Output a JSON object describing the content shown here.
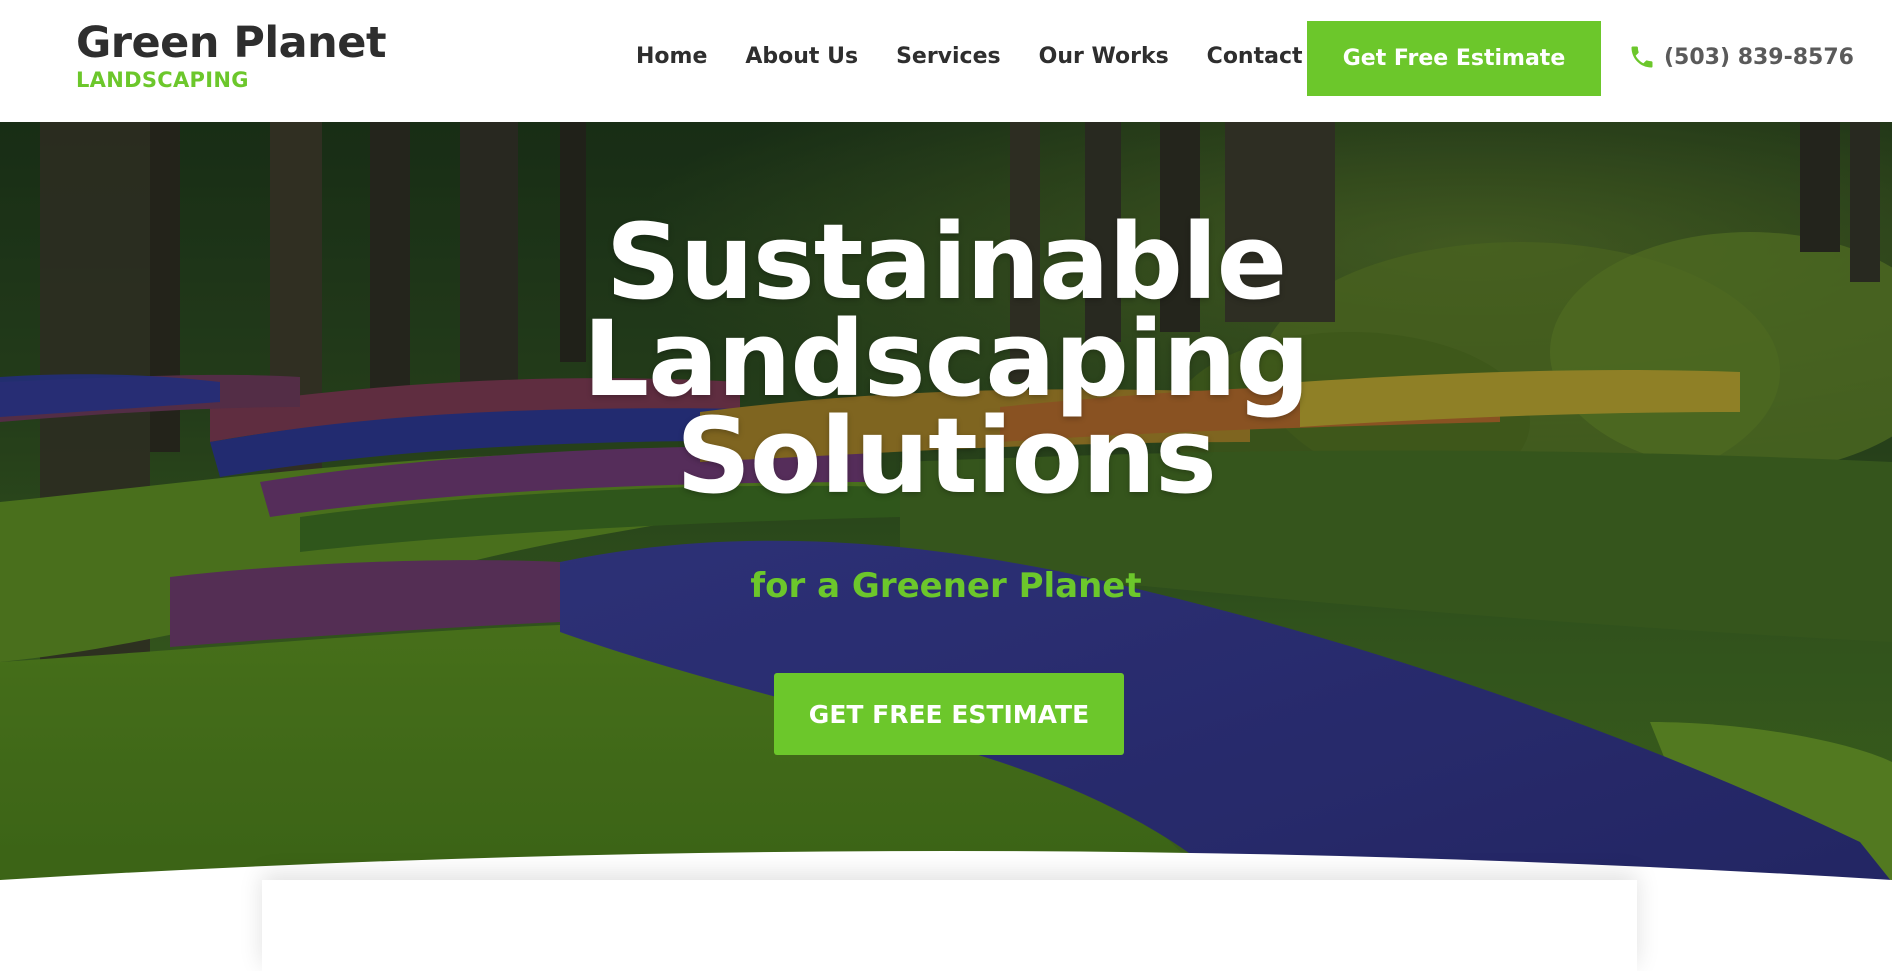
{
  "header": {
    "logo": {
      "title": "Green Planet",
      "subtitle": "LANDSCAPING"
    },
    "nav": [
      {
        "label": "Home"
      },
      {
        "label": "About Us"
      },
      {
        "label": "Services"
      },
      {
        "label": "Our Works"
      },
      {
        "label": "Contact"
      }
    ],
    "cta_label": "Get Free Estimate",
    "phone": {
      "icon": "phone-icon",
      "number": "(503) 839-8576"
    }
  },
  "hero": {
    "background": "garden-with-tulips-and-trees-photo",
    "title_lines": [
      "Sustainable",
      "Landscaping",
      "Solutions"
    ],
    "subtitle": "for a Greener Planet",
    "cta_label": "GET FREE ESTIMATE"
  },
  "colors": {
    "accent": "#6cc72b",
    "text_dark": "#2e2e2e",
    "text_muted": "#5a5a5a",
    "white": "#ffffff"
  }
}
